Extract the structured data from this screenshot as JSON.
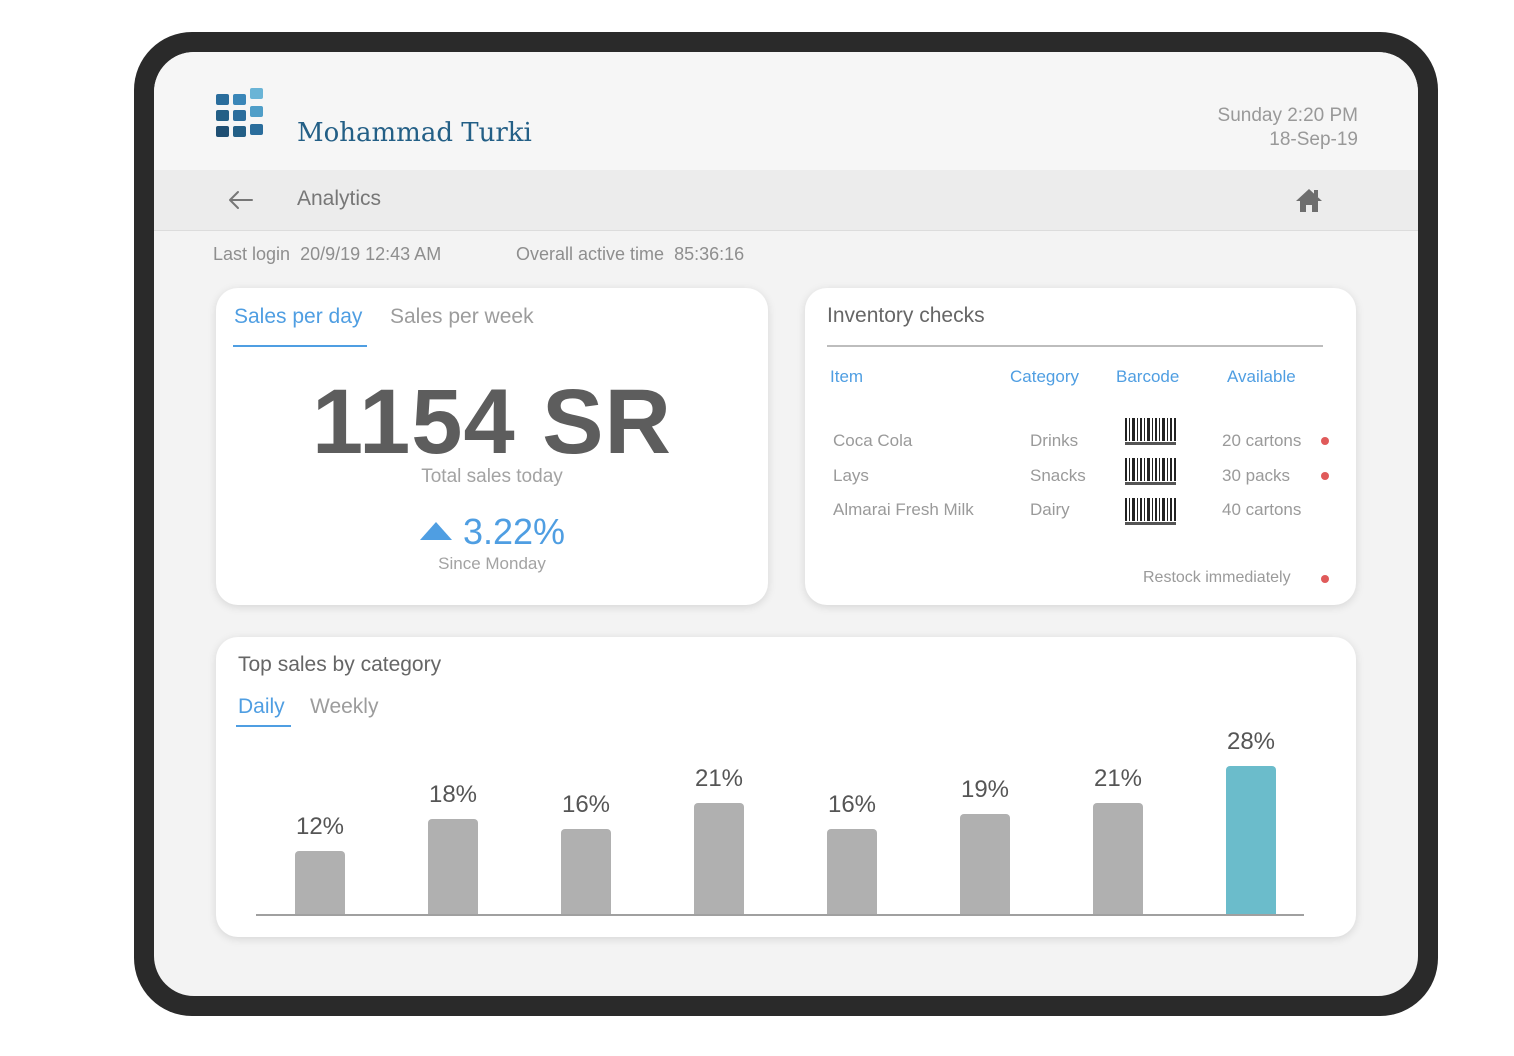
{
  "header": {
    "user_name": "Mohammad Turki",
    "day_time": "Sunday 2:20 PM",
    "date": "18-Sep-19"
  },
  "nav": {
    "title": "Analytics",
    "back_icon": "arrow-left-icon",
    "home_icon": "home-icon"
  },
  "meta": {
    "last_login_label": "Last login",
    "last_login_value": "20/9/19 12:43 AM",
    "active_label": "Overall active time",
    "active_value": "85:36:16"
  },
  "sales_card": {
    "tabs": [
      "Sales per day",
      "Sales per week"
    ],
    "active_tab": "Sales per day",
    "total": "1154 SR",
    "total_label": "Total sales today",
    "change": "3.22%",
    "change_direction": "up",
    "change_label": "Since Monday"
  },
  "inventory": {
    "title": "Inventory checks",
    "columns": [
      "Item",
      "Category",
      "Barcode",
      "Available"
    ],
    "rows": [
      {
        "item": "Coca Cola",
        "category": "Drinks",
        "available": "20 cartons",
        "alert": true
      },
      {
        "item": "Lays",
        "category": "Snacks",
        "available": "30 packs",
        "alert": true
      },
      {
        "item": "Almarai Fresh Milk",
        "category": "Dairy",
        "available": "40 cartons",
        "alert": false
      }
    ],
    "legend": "Restock immediately"
  },
  "top_sales": {
    "title": "Top sales by category",
    "tabs": [
      "Daily",
      "Weekly"
    ],
    "active_tab": "Daily"
  },
  "colors": {
    "accent": "#4f9ee2",
    "bar": "#b0b0b0",
    "highlight": "#6bbccb",
    "alert": "#e05a5a",
    "brand": "#235f86"
  },
  "chart_data": {
    "type": "bar",
    "categories": [
      "",
      "",
      "",
      "",
      "",
      "",
      "",
      ""
    ],
    "values": [
      12,
      18,
      16,
      21,
      16,
      19,
      21,
      28
    ],
    "data_labels": [
      "12%",
      "18%",
      "16%",
      "21%",
      "16%",
      "19%",
      "21%",
      "28%"
    ],
    "highlighted_index": 7,
    "title": "Top sales by category",
    "xlabel": "",
    "ylabel": "",
    "ylim": [
      0,
      28
    ],
    "grid": false
  }
}
